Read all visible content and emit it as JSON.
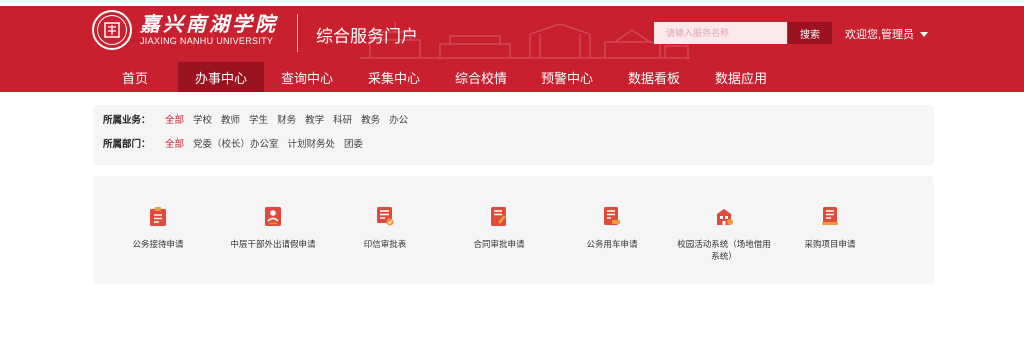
{
  "header": {
    "school_name_cn": "嘉兴南湖学院",
    "school_name_en": "JIAXING NANHU UNIVERSITY",
    "portal_title": "综合服务门户",
    "search_placeholder": "请输入服务名称",
    "search_button": "搜索",
    "welcome": "欢迎您,管理员",
    "brand_color": "#c8202f"
  },
  "nav": {
    "items": [
      {
        "label": "首页"
      },
      {
        "label": "办事中心",
        "active": true
      },
      {
        "label": "查询中心"
      },
      {
        "label": "采集中心"
      },
      {
        "label": "综合校情"
      },
      {
        "label": "预警中心"
      },
      {
        "label": "数据看板"
      },
      {
        "label": "数据应用"
      }
    ]
  },
  "filters": {
    "business": {
      "label": "所属业务：",
      "options": [
        "全部",
        "学校",
        "教师",
        "学生",
        "财务",
        "教学",
        "科研",
        "教务",
        "办公"
      ]
    },
    "department": {
      "label": "所属部门：",
      "options": [
        "全部",
        "党委（校长）办公室",
        "计划财务处",
        "团委"
      ]
    }
  },
  "apps": [
    {
      "label": "公务接待申请",
      "icon": "clipboard-doc-icon"
    },
    {
      "label": "中层干部外出请假申请",
      "icon": "person-badge-icon"
    },
    {
      "label": "印信审批表",
      "icon": "stamp-form-icon"
    },
    {
      "label": "合同审批申请",
      "icon": "contract-pen-icon"
    },
    {
      "label": "公务用车申请",
      "icon": "car-form-icon"
    },
    {
      "label": "校园活动系统（场地借用系统）",
      "icon": "building-icon"
    },
    {
      "label": "采购项目申请",
      "icon": "purchase-list-icon"
    }
  ]
}
